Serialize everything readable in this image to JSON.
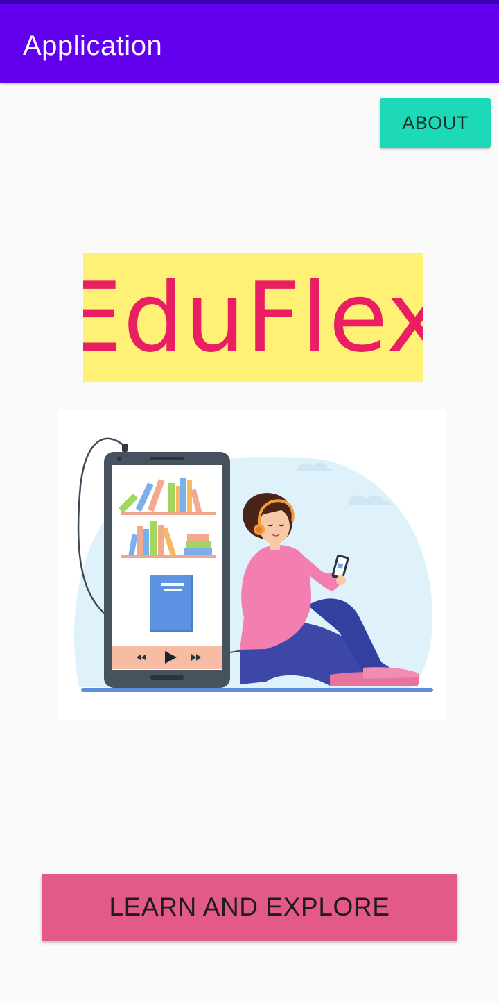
{
  "app_bar": {
    "title": "Application"
  },
  "buttons": {
    "about": "ABOUT",
    "learn": "LEARN AND EXPLORE"
  },
  "logo": {
    "text": "EduFlex"
  },
  "illustration": {
    "icon": "woman-listening-audiobook-illustration"
  },
  "colors": {
    "status_bar": "#3700b3",
    "app_bar": "#6200ee",
    "about_button": "#1dd9b7",
    "logo_background": "#fff176",
    "logo_text": "#e91e63",
    "learn_button": "#e35a87"
  }
}
